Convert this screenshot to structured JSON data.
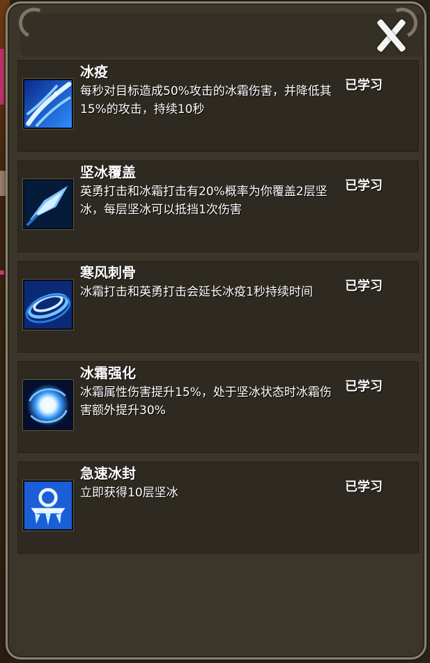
{
  "dialog": {
    "close_icon": "close-x-icon"
  },
  "skills": [
    {
      "name": "冰疫",
      "description": "每秒对目标造成50%攻击的冰霜伤害，并降低其15%的攻击，持续10秒",
      "status": "已学习",
      "icon": "frost-streak-icon"
    },
    {
      "name": "坚冰覆盖",
      "description": "英勇打击和冰霜打击有20%概率为你覆盖2层坚冰，每层坚冰可以抵挡1次伤害",
      "status": "已学习",
      "icon": "ice-shard-icon"
    },
    {
      "name": "寒风刺骨",
      "description": "冰霜打击和英勇打击会延长冰疫1秒持续时间",
      "status": "已学习",
      "icon": "frost-whirlwind-icon"
    },
    {
      "name": "冰霜强化",
      "description": "冰霜属性伤害提升15%，处于坚冰状态时冰霜伤害额外提升30%",
      "status": "已学习",
      "icon": "frost-orb-icon"
    },
    {
      "name": "急速冰封",
      "description": "立即获得10层坚冰",
      "status": "已学习",
      "icon": "ice-crown-icon"
    }
  ]
}
